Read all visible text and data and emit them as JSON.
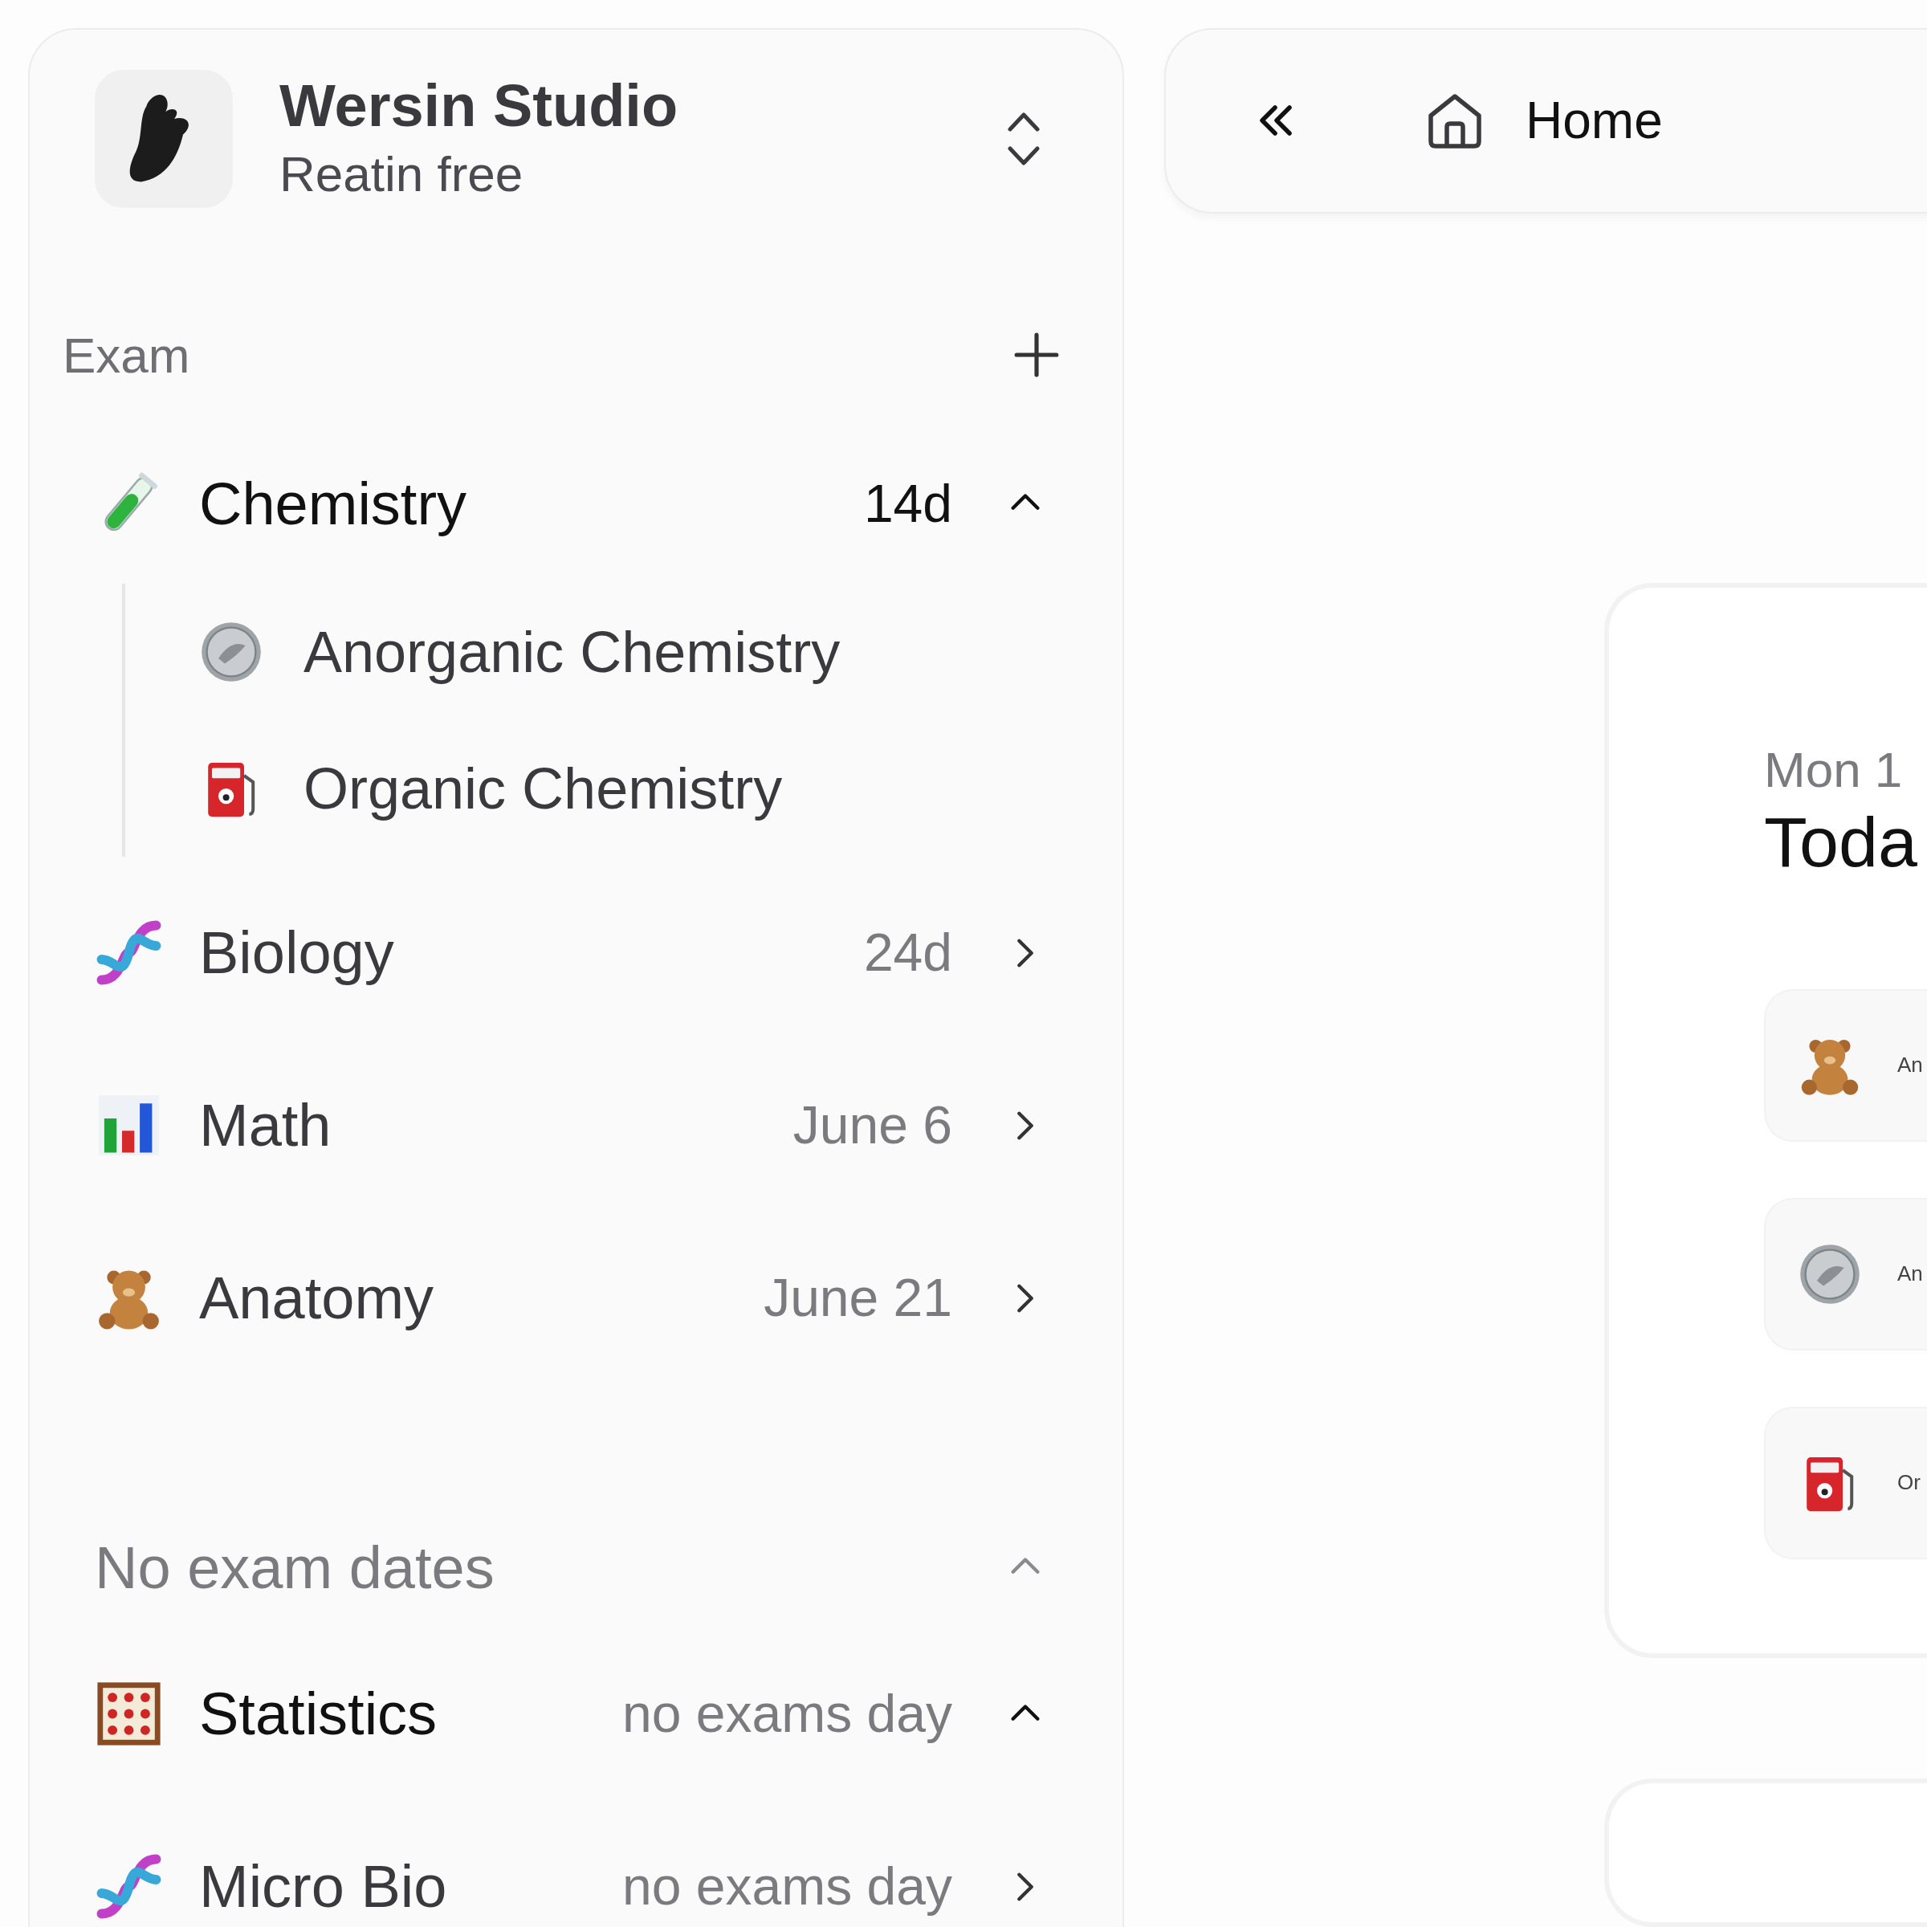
{
  "workspace": {
    "name": "Wersin Studio",
    "plan": "Reatin free"
  },
  "sections": [
    {
      "title": "Exam",
      "subjects": [
        {
          "label": "Chemistry",
          "count": "14d",
          "urgent": true,
          "expanded": true,
          "children": [
            {
              "label": "Anorganic Chemistry"
            },
            {
              "label": "Organic Chemistry"
            }
          ]
        },
        {
          "label": "Biology",
          "count": "24d",
          "urgent": false,
          "expanded": false
        },
        {
          "label": "Math",
          "count": "June 6",
          "urgent": false,
          "expanded": false
        },
        {
          "label": "Anatomy",
          "count": "June 21",
          "urgent": false,
          "expanded": false
        }
      ]
    },
    {
      "title": "No exam dates",
      "expanded": true,
      "subjects": [
        {
          "label": "Statistics",
          "count": "no exams day",
          "urgent": false,
          "expanded": true
        },
        {
          "label": "Micro Bio",
          "count": "no exams day",
          "urgent": false,
          "expanded": false
        }
      ]
    }
  ],
  "topbar": {
    "title": "Home"
  },
  "today_card": {
    "date": "Mon 1",
    "heading": "Toda",
    "items": [
      {
        "label": "An"
      },
      {
        "label": "An"
      },
      {
        "label": "Or"
      }
    ]
  }
}
